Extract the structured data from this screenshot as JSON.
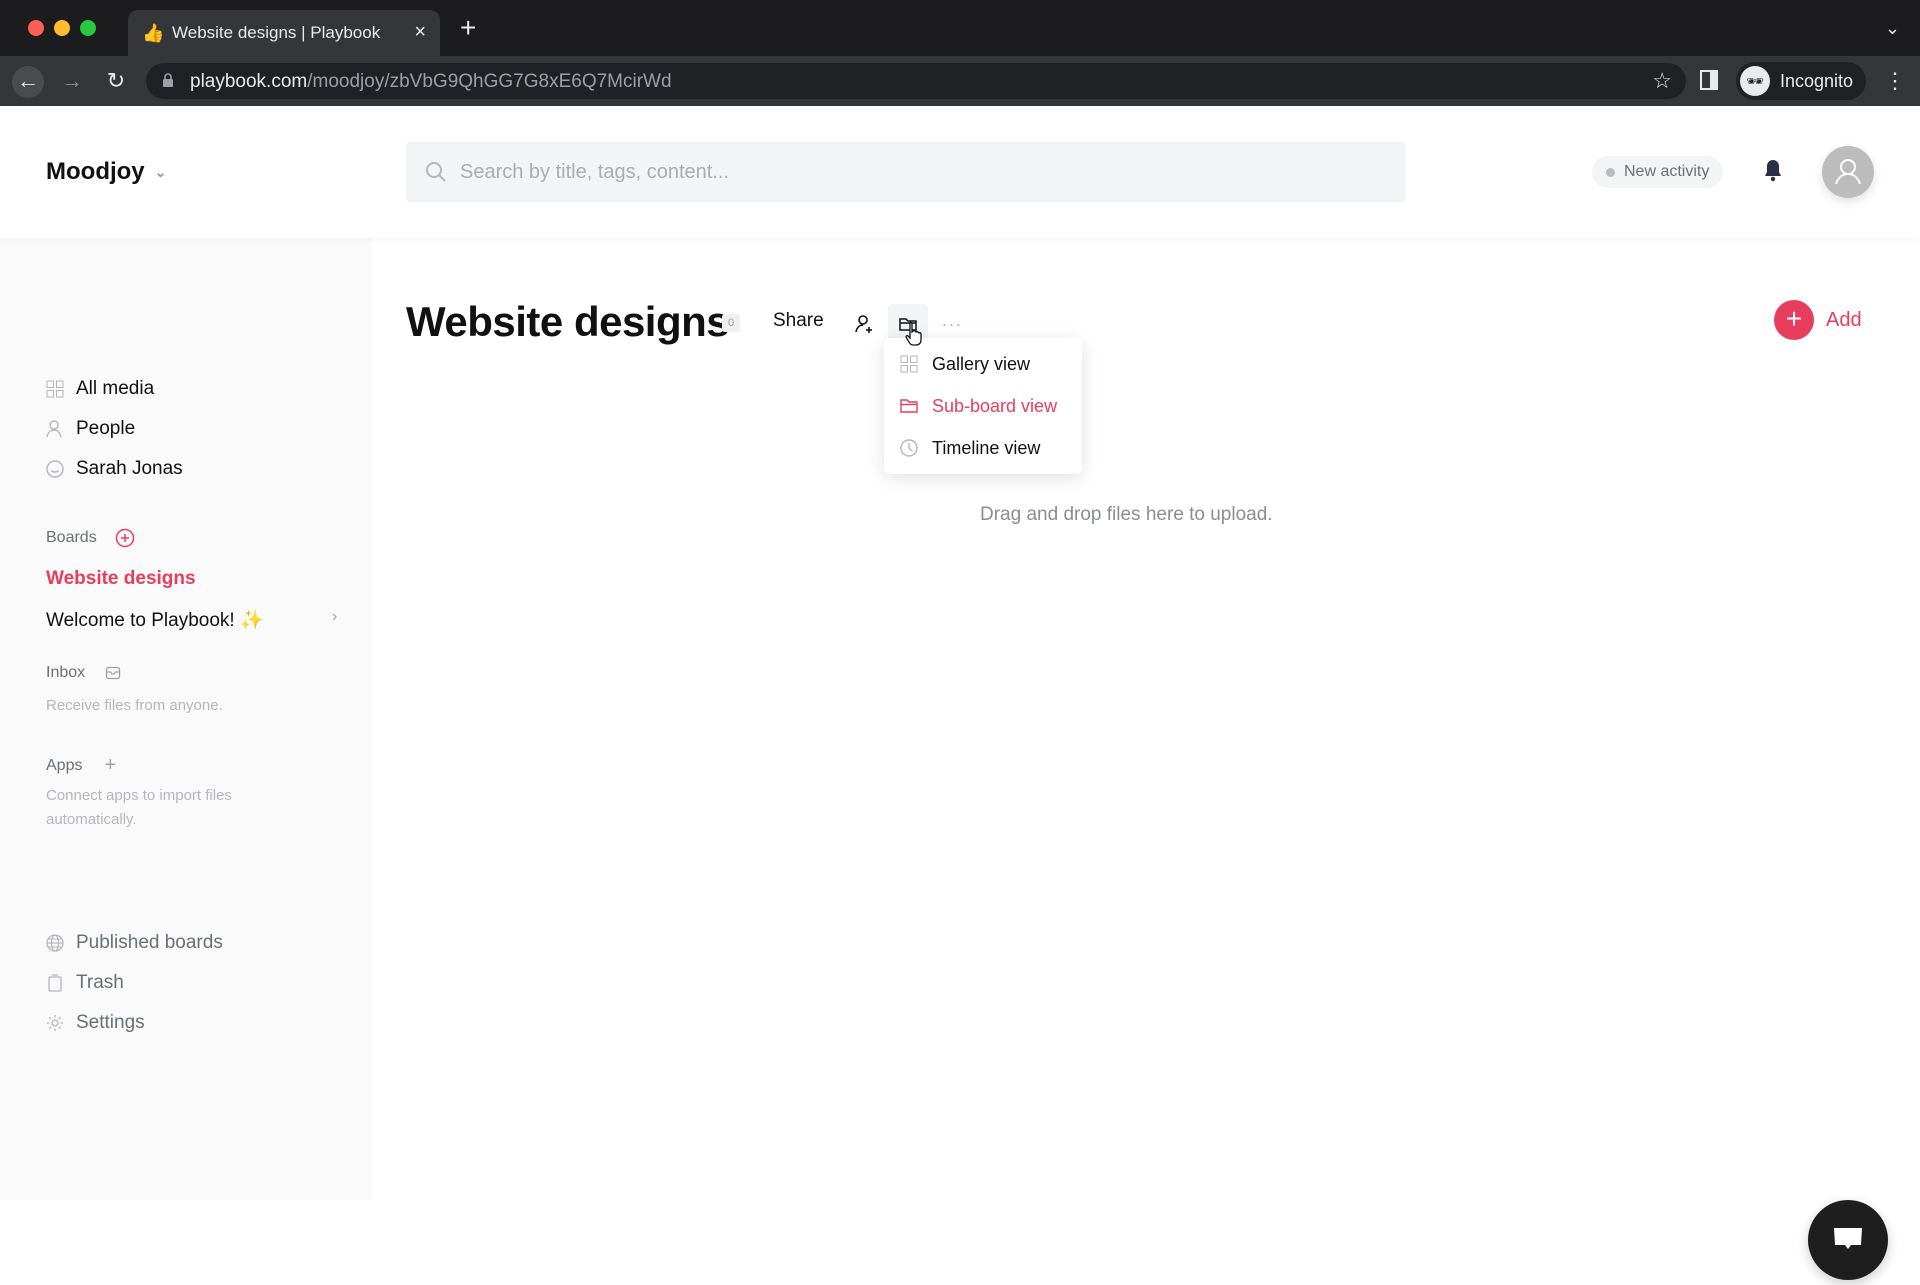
{
  "browser": {
    "tab_title": "Website designs | Playbook",
    "url_host": "playbook.com",
    "url_path": "/moodjoy/zbVbG9QhGG7G8xE6Q7McirWd",
    "profile_label": "Incognito"
  },
  "header": {
    "workspace": "Moodjoy",
    "search_placeholder": "Search by title, tags, content...",
    "activity_label": "New activity"
  },
  "sidebar": {
    "nav": [
      {
        "label": "All media",
        "icon": "grid-icon"
      },
      {
        "label": "People",
        "icon": "person-icon"
      },
      {
        "label": "Sarah Jonas",
        "icon": "smiley-icon"
      }
    ],
    "boards_label": "Boards",
    "boards": [
      {
        "label": "Website designs",
        "active": true
      },
      {
        "label": "Welcome to Playbook! ✨",
        "active": false
      }
    ],
    "inbox_label": "Inbox",
    "inbox_hint": "Receive files from anyone.",
    "apps_label": "Apps",
    "apps_hint": "Connect apps to import files automatically.",
    "footer": [
      {
        "label": "Published boards",
        "icon": "globe-icon"
      },
      {
        "label": "Trash",
        "icon": "trash-icon"
      },
      {
        "label": "Settings",
        "icon": "gear-icon"
      }
    ]
  },
  "main": {
    "title": "Website designs",
    "count": "0",
    "share_label": "Share",
    "more_label": "···",
    "add_label": "Add",
    "dropzone_text": "Drag and drop files here to upload.",
    "view_menu": [
      {
        "label": "Gallery view",
        "icon": "grid-icon",
        "active": false
      },
      {
        "label": "Sub-board view",
        "icon": "folder-icon",
        "active": true
      },
      {
        "label": "Timeline view",
        "icon": "clock-icon",
        "active": false
      }
    ]
  },
  "colors": {
    "accent": "#e63e5c",
    "chrome_bg": "#202124",
    "sidebar_bg": "#fafafb"
  }
}
